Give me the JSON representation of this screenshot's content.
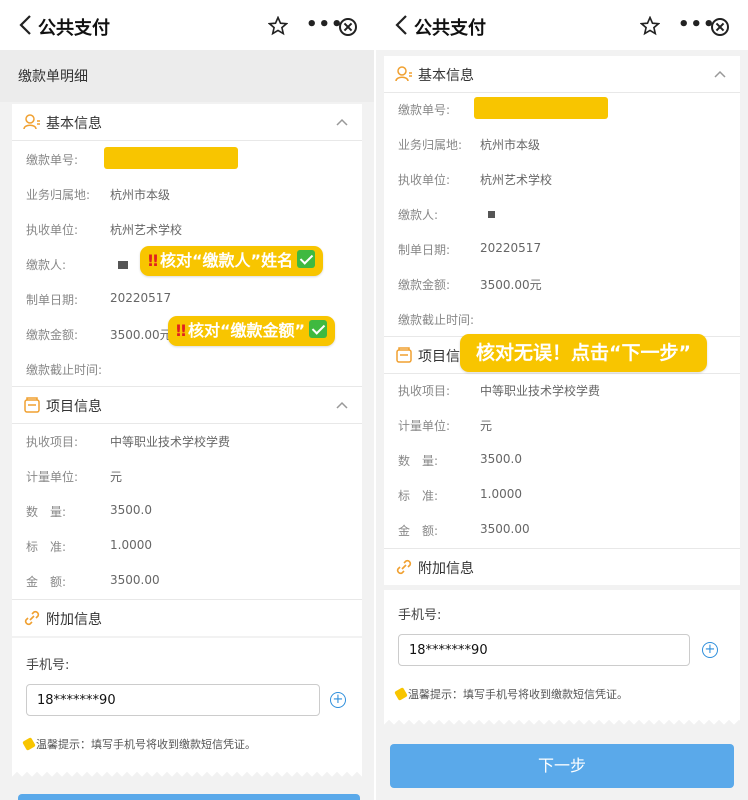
{
  "nav": {
    "title": "公共支付",
    "more": "•••"
  },
  "subheader": {
    "title": "缴款单明细"
  },
  "basic_info": {
    "title": "基本信息",
    "rows": [
      {
        "label": "缴款单号:",
        "value": ""
      },
      {
        "label": "业务归属地:",
        "value": "杭州市本级"
      },
      {
        "label": "执收单位:",
        "value": "杭州艺术学校"
      },
      {
        "label": "缴款人:",
        "value": ""
      },
      {
        "label": "制单日期:",
        "value": "20220517"
      },
      {
        "label": "缴款金额:",
        "value": "3500.00元"
      },
      {
        "label": "缴款截止时间:",
        "value": ""
      }
    ]
  },
  "project_info": {
    "title": "项目信息",
    "rows": [
      {
        "label": "执收项目:",
        "value": "中等职业技术学校学费"
      },
      {
        "label": "计量单位:",
        "value": "元"
      },
      {
        "label": "数　量:",
        "value": "3500.0"
      },
      {
        "label": "标　准:",
        "value": "1.0000"
      },
      {
        "label": "金　额:",
        "value": "3500.00"
      }
    ]
  },
  "extra_info": {
    "title": "附加信息"
  },
  "mobile": {
    "label": "手机号:",
    "value": "18*******90",
    "plus": "+"
  },
  "tip": {
    "text": "温馨提示：填写手机号将收到缴款短信凭证。"
  },
  "next_button": {
    "label": "下一步"
  },
  "annotations": {
    "check_payer": "核对“缴款人”姓名",
    "check_amount": "核对“缴款金额”",
    "confirm_next": "核对无误！点击“下一步”",
    "warn_mark": "‼"
  },
  "colors": {
    "accent": "#5aa9ea",
    "highlight": "#f8c500",
    "link_blue": "#2f8fdc",
    "check_green": "#3fb940",
    "warn_red": "#e02020"
  }
}
